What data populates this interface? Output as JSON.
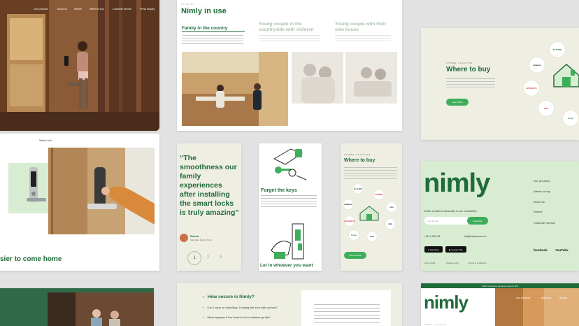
{
  "hero_card": {
    "nav": [
      "Our products",
      "About us",
      "Stories",
      "Where to buy",
      "Customer service",
      "Press enquiry"
    ]
  },
  "home_card": {
    "label": "Smart Lock",
    "headline": "sier to come home"
  },
  "stories_card": {
    "eyebrow": "STORIES",
    "title": "Nimly in use",
    "tab_active": "Family in the country",
    "tab_2": "Young couple in the countryside with children",
    "tab_3": "Young couple with their own house"
  },
  "quote_card": {
    "quote": "“The smoothness our family experiences after installing the smart locks is truly amazing”",
    "author": "Emma",
    "author_sub": "Suburban family of four",
    "pages": [
      "1",
      "2",
      "3"
    ]
  },
  "keys_card": {
    "title_1": "Forget the keys",
    "title_2": "Let in whoever you want"
  },
  "buy_mobile_card": {
    "eyebrow": "STORE LOCATOR",
    "title": "Where to buy",
    "button": "Store locator",
    "logos": [
      "ELKJØP",
      "POWER",
      "amazon",
      "clas",
      "BAUHAUS",
      "Jula",
      "Coop",
      "Clas"
    ]
  },
  "buy_desktop_card": {
    "eyebrow": "STORE LOCATOR",
    "title": "Where to buy",
    "button": "Learn More",
    "logos": [
      "ELKJØP",
      "amazon",
      "BAUHAUS",
      "Clas",
      "Coop"
    ]
  },
  "footer_card": {
    "logo": "nimly",
    "newsletter": "Enter e-mail to subscribe to our newsletter",
    "email_placeholder": "Your E-mail",
    "subscribe": "Subscribe",
    "phone": "+46 10 458 763",
    "email": "info@nimlyhouse.com",
    "app_store": "App Store",
    "google_play": "Google Play",
    "links": [
      "Our products",
      "Where to buy",
      "About us",
      "Stories",
      "Customer service"
    ],
    "social_1": "facebook",
    "social_2": "YouTube",
    "copyright": "Nimly 2023",
    "privacy": "Privacy policy",
    "terms": "Terms & conditions"
  },
  "faq_card": {
    "title": "How secure is Nimly?",
    "q1": "Can I carry on unlocking, I locking the door with my key?",
    "q2": "What happens if the Smart Lock's batteries go flat?"
  },
  "nimly_hero_card": {
    "banner": "Click Commerce Generate sale for IPG",
    "logo": "nimly",
    "nav": [
      "Our products",
      "About us",
      "Stories"
    ],
    "eyebrow": "NEW LAUNCH"
  },
  "colors": {
    "brand_green": "#1f6b3a",
    "accent_green": "#3fae5a",
    "pale_green": "#d8ecd2",
    "beige": "#efeee3"
  }
}
